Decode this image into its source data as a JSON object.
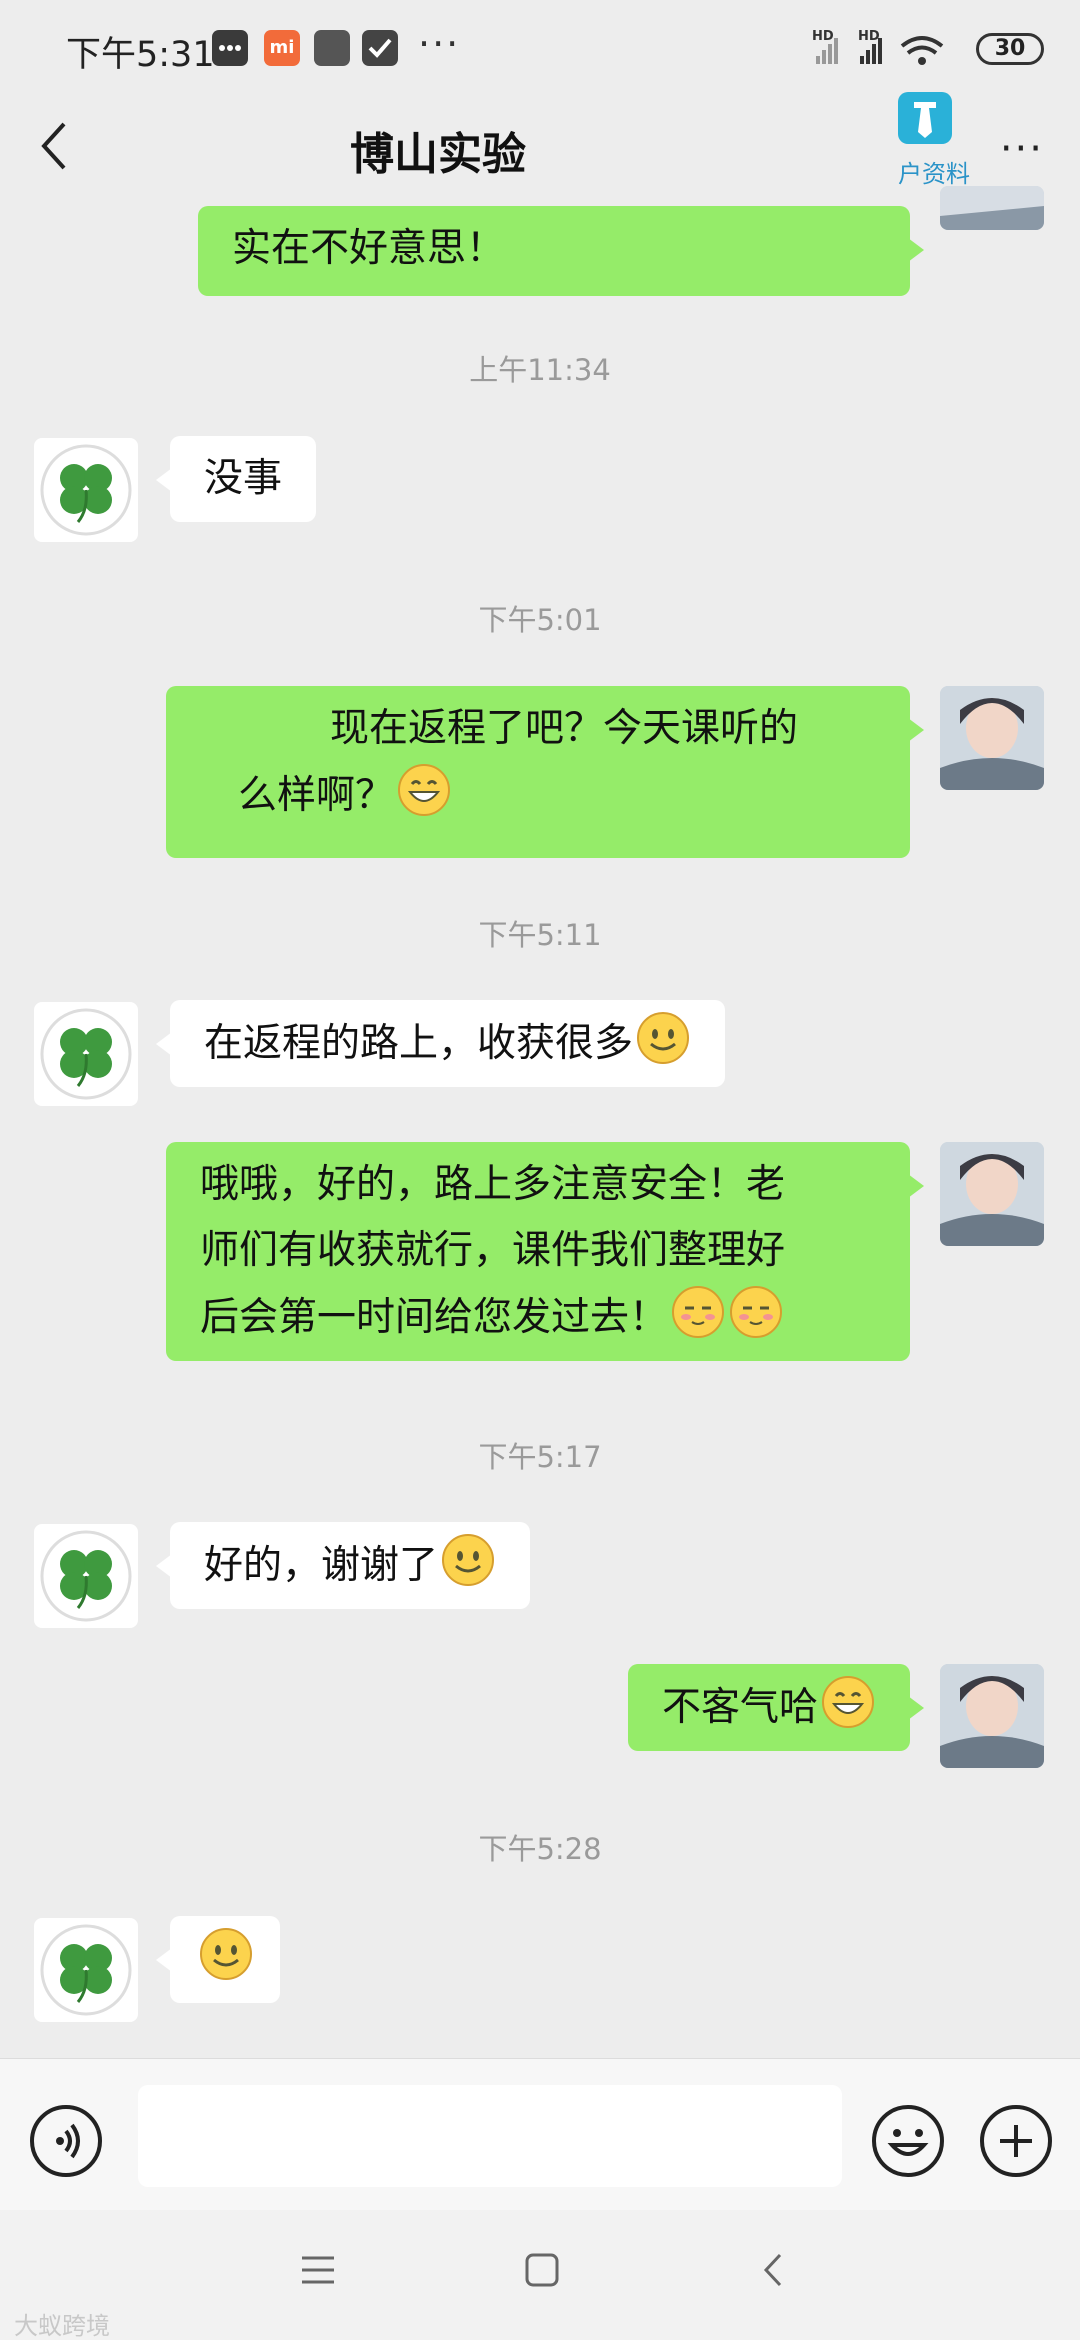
{
  "status_bar": {
    "time": "下午5:31",
    "network_labels": [
      "HD",
      "HD"
    ],
    "battery": "30",
    "more": "···"
  },
  "header": {
    "title": "博山实验",
    "profile_label": "户资料",
    "more": "···"
  },
  "messages": [
    {
      "type": "bubble",
      "side": "out",
      "lines": [
        "实在不好意思！"
      ]
    },
    {
      "type": "time",
      "text": "上午11:34"
    },
    {
      "type": "bubble",
      "side": "in",
      "lines": [
        "没事"
      ]
    },
    {
      "type": "time",
      "text": "下午5:01"
    },
    {
      "type": "bubble",
      "side": "out",
      "lines": [
        "现在返程了吧？今天课听的",
        "么样啊？"
      ],
      "emoji": [
        "grin"
      ]
    },
    {
      "type": "time",
      "text": "下午5:11"
    },
    {
      "type": "bubble",
      "side": "in",
      "lines": [
        "在返程的路上，收获很多"
      ],
      "emoji": [
        "smile"
      ]
    },
    {
      "type": "bubble",
      "side": "out",
      "lines": [
        "哦哦，好的，路上多注意安全！老",
        "师们有收获就行，课件我们整理好",
        "后会第一时间给您发过去！"
      ],
      "emoji": [
        "shy",
        "shy"
      ]
    },
    {
      "type": "time",
      "text": "下午5:17"
    },
    {
      "type": "bubble",
      "side": "in",
      "lines": [
        "好的，谢谢了"
      ],
      "emoji": [
        "smile"
      ]
    },
    {
      "type": "bubble",
      "side": "out",
      "lines": [
        "不客气哈"
      ],
      "emoji": [
        "grin"
      ]
    },
    {
      "type": "time",
      "text": "下午5:28"
    },
    {
      "type": "bubble",
      "side": "in",
      "lines": [
        ""
      ],
      "emoji": [
        "smile"
      ]
    }
  ],
  "input_bar": {
    "voice_icon": "voice-icon",
    "emoji_icon": "emoji-icon",
    "plus_icon": "plus-icon",
    "value": ""
  },
  "nav_bar": {
    "icons": [
      "menu-icon",
      "home-icon",
      "back-icon"
    ]
  },
  "watermark": "大蚁跨境",
  "colors": {
    "background": "#ededed",
    "outgoing_bubble": "#95ec69",
    "incoming_bubble": "#ffffff",
    "timestamp": "#9a9a9a"
  }
}
